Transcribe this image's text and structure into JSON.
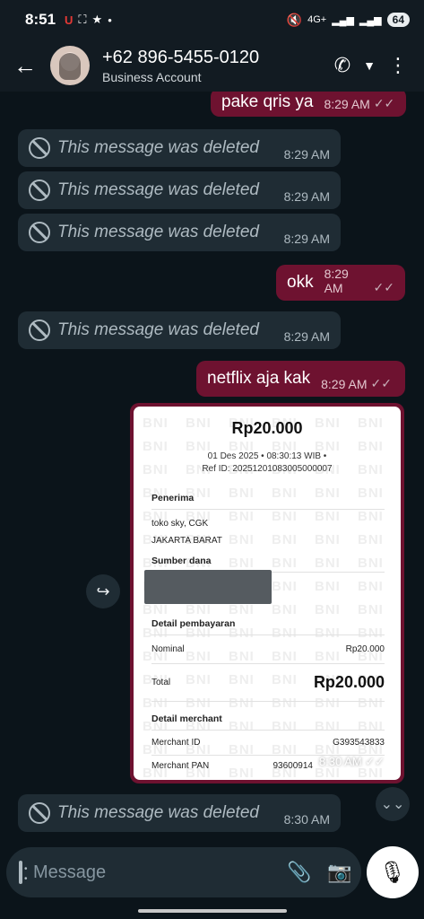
{
  "status": {
    "time": "8:51",
    "network": "4G+",
    "battery": "64"
  },
  "header": {
    "name": "+62 896-5455-0120",
    "subtitle": "Business Account"
  },
  "messages": [
    {
      "type": "out",
      "text": "pake qris ya",
      "time": "8:29 AM"
    },
    {
      "type": "in",
      "text": "This message was deleted",
      "time": "8:29 AM"
    },
    {
      "type": "in",
      "text": "This message was deleted",
      "time": "8:29 AM"
    },
    {
      "type": "in",
      "text": "This message was deleted",
      "time": "8:29 AM"
    },
    {
      "type": "out",
      "text": "okk",
      "time": "8:29 AM"
    },
    {
      "type": "in",
      "text": "This message was deleted",
      "time": "8:29 AM"
    },
    {
      "type": "out",
      "text": "netflix aja kak",
      "time": "8:29 AM"
    },
    {
      "type": "in",
      "text": "This message was deleted",
      "time": "8:30 AM"
    }
  ],
  "receipt": {
    "amount": "Rp20.000",
    "date": "01 Des 2025 • 08:30:13 WIB •",
    "ref": "Ref ID: 20251201083005000007",
    "penerima_label": "Penerima",
    "penerima_name": "toko sky, CGK",
    "penerima_city": "JAKARTA BARAT",
    "sumber_label": "Sumber dana",
    "detail_label": "Detail pembayaran",
    "nominal_label": "Nominal",
    "nominal_value": "Rp20.000",
    "total_label": "Total",
    "total_value": "Rp20.000",
    "merchant_label": "Detail merchant",
    "merchant_id_label": "Merchant ID",
    "merchant_id_value": "G393543833",
    "merchant_pan_label": "Merchant PAN",
    "merchant_pan_value": "93600914",
    "watermark": "BNI",
    "time": "8:30 AM"
  },
  "composer": {
    "placeholder": "Message"
  },
  "colors": {
    "background": "#0b141a",
    "incoming": "#1f2c34",
    "outgoing": "#6e1230"
  }
}
